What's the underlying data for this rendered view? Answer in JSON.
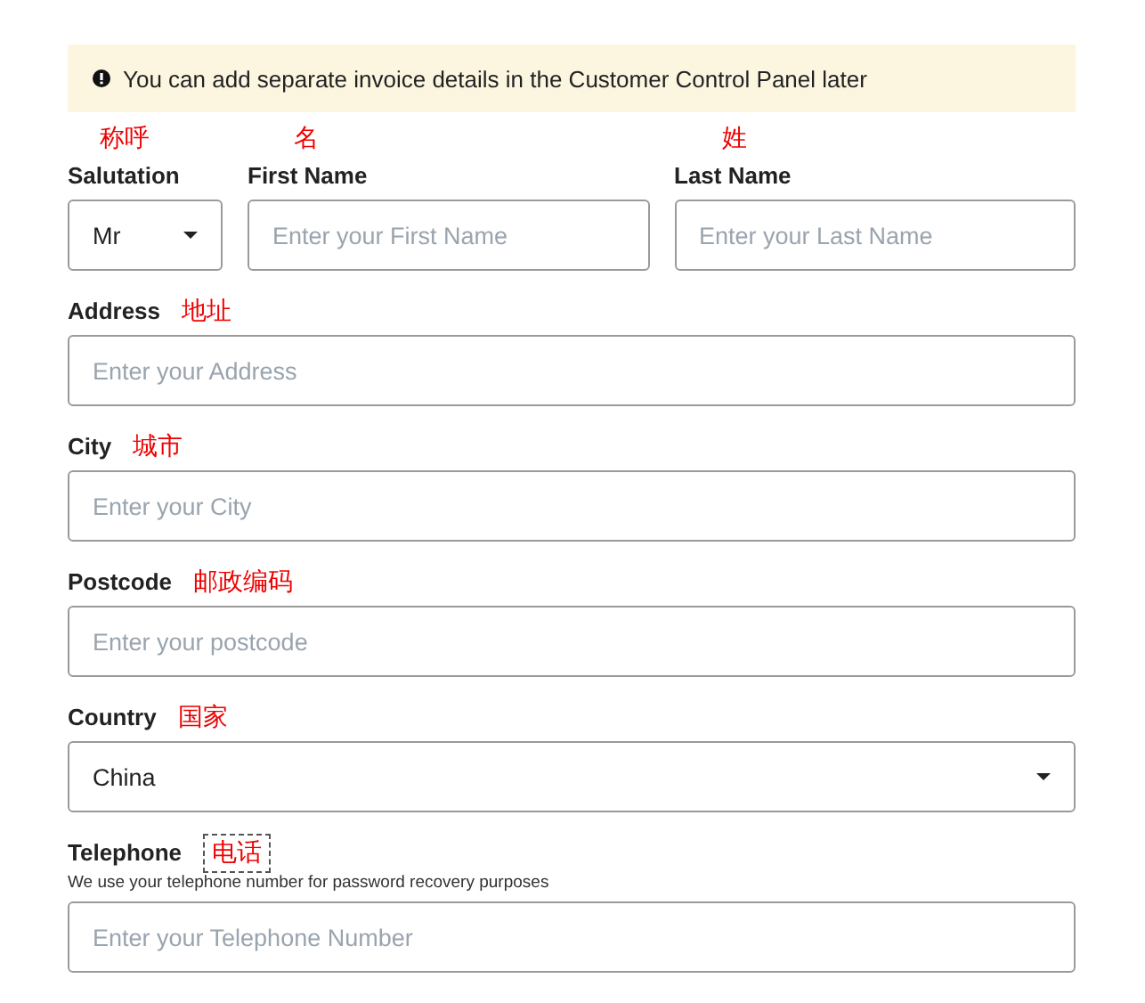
{
  "notice": {
    "text": "You can add separate invoice details in the Customer Control Panel later"
  },
  "name_row": [
    {
      "label": "Salutation",
      "annotation": "称呼",
      "kind": "select",
      "value": "Mr"
    },
    {
      "label": "First Name",
      "annotation": "名",
      "kind": "input",
      "placeholder": "Enter your First Name"
    },
    {
      "label": "Last Name",
      "annotation": "姓",
      "kind": "input",
      "placeholder": "Enter your Last Name"
    }
  ],
  "fields": [
    {
      "label": "Address",
      "annotation": "地址",
      "annotation_boxed": false,
      "kind": "input",
      "placeholder": "Enter your Address"
    },
    {
      "label": "City",
      "annotation": "城市",
      "annotation_boxed": false,
      "kind": "input",
      "placeholder": "Enter your City"
    },
    {
      "label": "Postcode",
      "annotation": "邮政编码",
      "annotation_boxed": false,
      "kind": "input",
      "placeholder": "Enter your postcode"
    },
    {
      "label": "Country",
      "annotation": "国家",
      "annotation_boxed": false,
      "kind": "select",
      "value": "China"
    },
    {
      "label": "Telephone",
      "annotation": "电话",
      "annotation_boxed": true,
      "help": "We use your telephone number for password recovery purposes",
      "kind": "input",
      "placeholder": "Enter your Telephone Number"
    }
  ]
}
